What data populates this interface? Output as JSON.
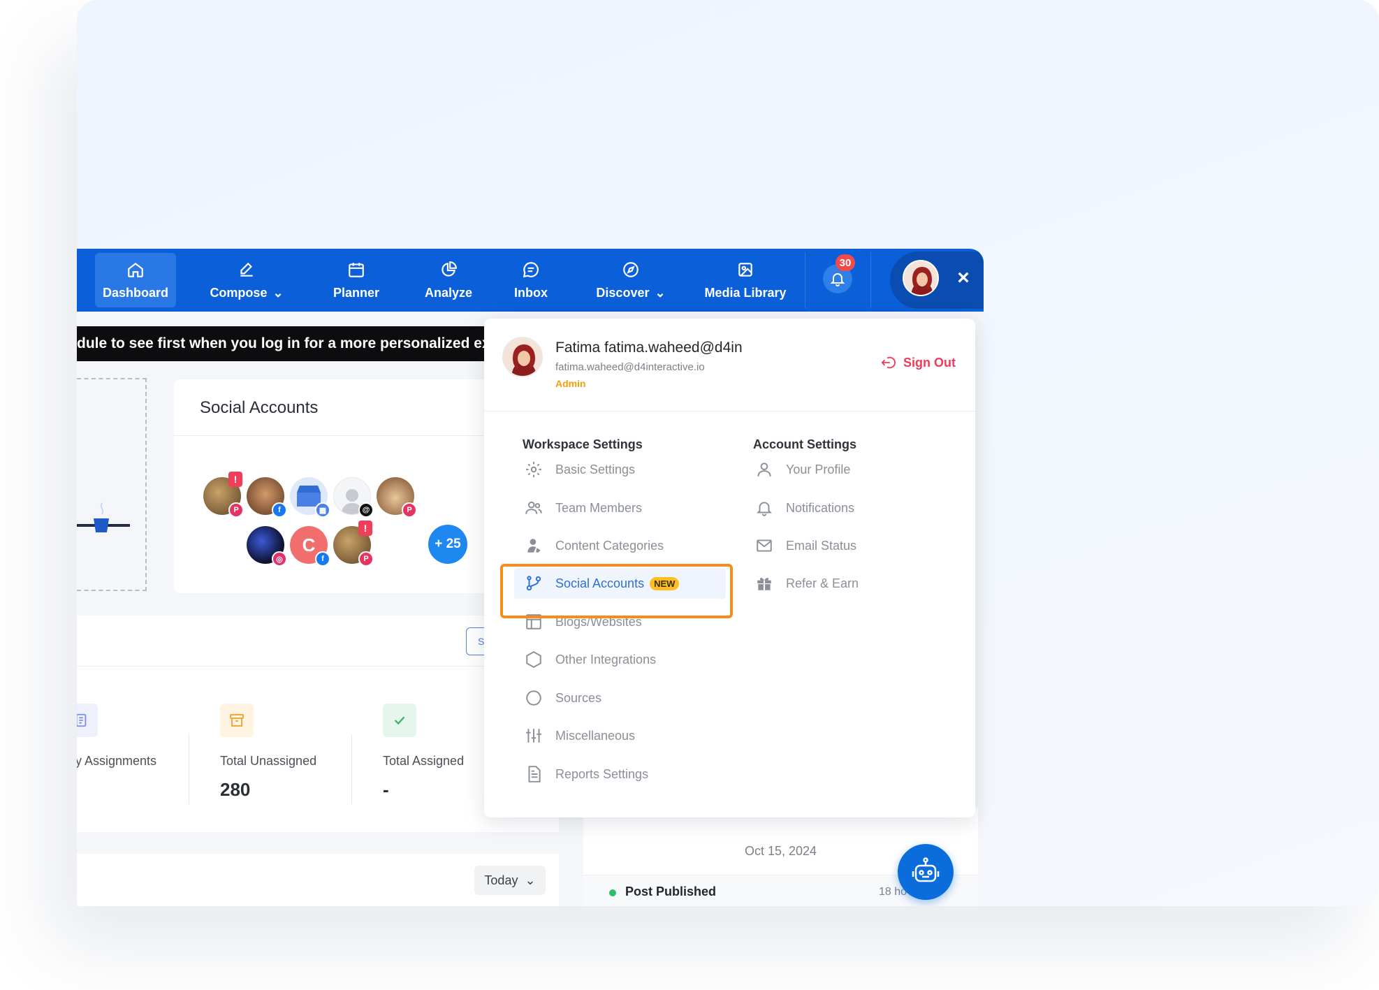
{
  "nav": {
    "items": [
      {
        "label": "Dashboard",
        "icon": "home-icon"
      },
      {
        "label": "Compose",
        "icon": "pen-icon"
      },
      {
        "label": "Planner",
        "icon": "calendar-icon"
      },
      {
        "label": "Analyze",
        "icon": "pie-chart-icon"
      },
      {
        "label": "Inbox",
        "icon": "chat-icon"
      },
      {
        "label": "Discover",
        "icon": "compass-icon"
      },
      {
        "label": "Media Library",
        "icon": "image-icon"
      }
    ],
    "notification_count": "30",
    "close_glyph": "×"
  },
  "banner": {
    "text": "dule to see first when you log in for a more personalized exp"
  },
  "social_panel": {
    "title": "Social Accounts",
    "more_count": "+ 25",
    "warning_glyph": "!",
    "avatar_letter": "C"
  },
  "assign_panel": {
    "search_btn_letter": "S",
    "stats": [
      {
        "label": "y Assignments",
        "value": ""
      },
      {
        "label": "Total Unassigned",
        "value": "280"
      },
      {
        "label": "Total Assigned",
        "value": "-"
      }
    ]
  },
  "today_panel": {
    "filter_label": "Today"
  },
  "activity": {
    "date": "Oct 15, 2024",
    "post_label": "Post Published",
    "post_time": "18 ho"
  },
  "user_menu": {
    "name": "Fatima fatima.waheed@d4in",
    "email": "fatima.waheed@d4interactive.io",
    "role": "Admin",
    "sign_out": "Sign Out",
    "workspace_title": "Workspace Settings",
    "account_title": "Account Settings",
    "workspace_items": [
      {
        "label": "Basic Settings",
        "icon": "gear-icon"
      },
      {
        "label": "Team Members",
        "icon": "users-icon"
      },
      {
        "label": "Content Categories",
        "icon": "user-tag-icon"
      },
      {
        "label": "Social Accounts",
        "icon": "branch-icon",
        "badge": "NEW"
      },
      {
        "label": "Blogs/Websites",
        "icon": "layout-icon"
      },
      {
        "label": "Other Integrations",
        "icon": "hexagon-icon"
      },
      {
        "label": "Sources",
        "icon": "circle-icon"
      },
      {
        "label": "Miscellaneous",
        "icon": "sliders-icon"
      },
      {
        "label": "Reports Settings",
        "icon": "document-icon"
      }
    ],
    "account_items": [
      {
        "label": "Your Profile",
        "icon": "user-icon"
      },
      {
        "label": "Notifications",
        "icon": "bell-icon"
      },
      {
        "label": "Email Status",
        "icon": "envelope-icon"
      },
      {
        "label": "Refer & Earn",
        "icon": "gift-icon"
      }
    ]
  },
  "colors": {
    "nav_blue": "#0b5fd9",
    "accent_orange": "#f78c1d",
    "signout_red": "#ef3b58",
    "admin_orange": "#f59e0b"
  }
}
